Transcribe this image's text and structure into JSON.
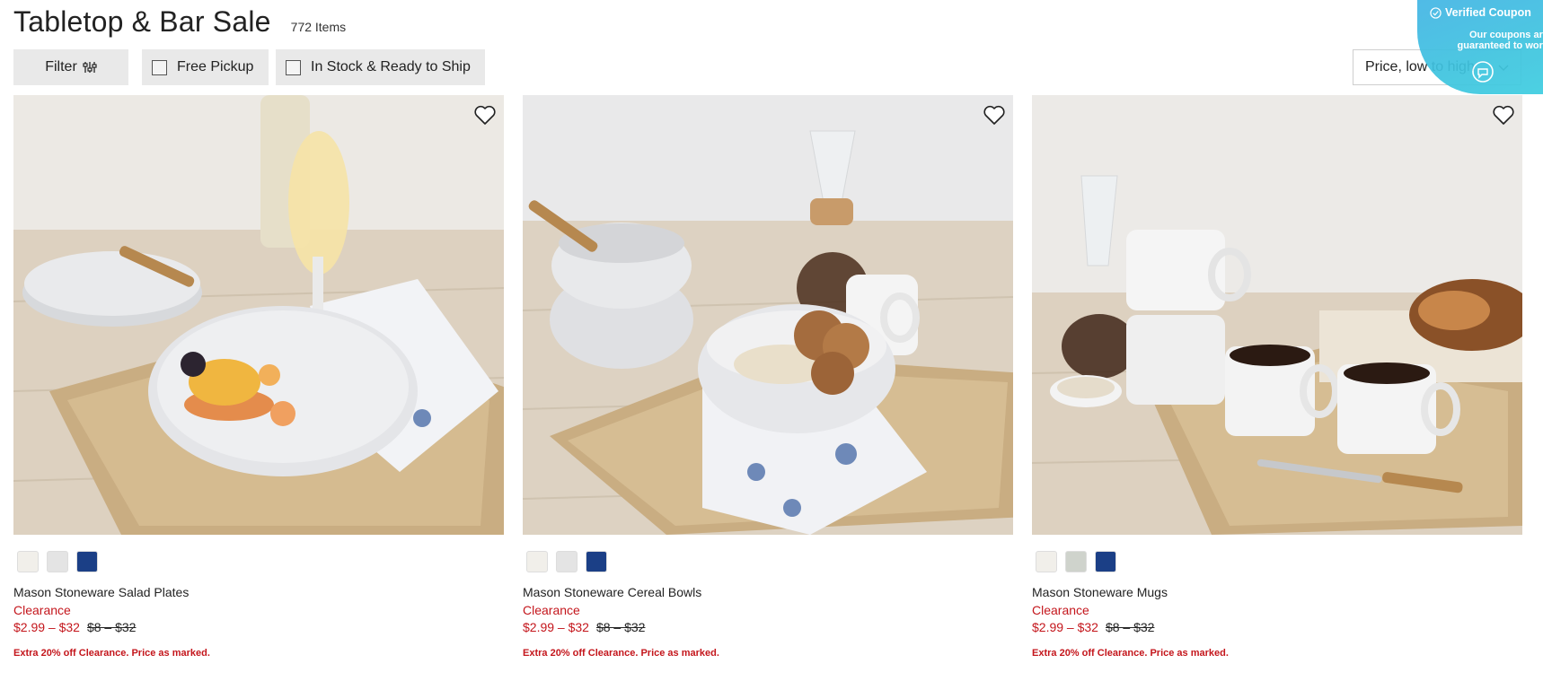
{
  "header": {
    "title": "Tabletop & Bar Sale",
    "item_count": "772 Items"
  },
  "filters": {
    "filter_label": "Filter",
    "free_pickup_label": "Free Pickup",
    "in_stock_label": "In Stock & Ready to Ship"
  },
  "sort": {
    "selected": "Price, low to high"
  },
  "coupon": {
    "title": "Verified Coupon",
    "text": "Our coupons are guaranteed to work"
  },
  "products": [
    {
      "name": "Mason Stoneware Salad Plates",
      "status": "Clearance",
      "price": "$2.99 – $32",
      "original_price": "$8 – $32",
      "promo": "Extra 20% off Clearance. Price as marked.",
      "swatches": [
        "#f1efea",
        "#e4e4e4",
        "#1b3f86"
      ]
    },
    {
      "name": "Mason Stoneware Cereal Bowls",
      "status": "Clearance",
      "price": "$2.99 – $32",
      "original_price": "$8 – $32",
      "promo": "Extra 20% off Clearance. Price as marked.",
      "swatches": [
        "#f1efea",
        "#e4e4e4",
        "#1b3f86"
      ]
    },
    {
      "name": "Mason Stoneware Mugs",
      "status": "Clearance",
      "price": "$2.99 – $32",
      "original_price": "$8 – $32",
      "promo": "Extra 20% off Clearance. Price as marked.",
      "swatches": [
        "#f1efea",
        "#cfd3cc",
        "#1b3f86"
      ]
    }
  ],
  "colors": {
    "accent_red": "#c4161c",
    "chip_bg": "#e9e9e9",
    "coupon_blue": "#3fbde2"
  }
}
